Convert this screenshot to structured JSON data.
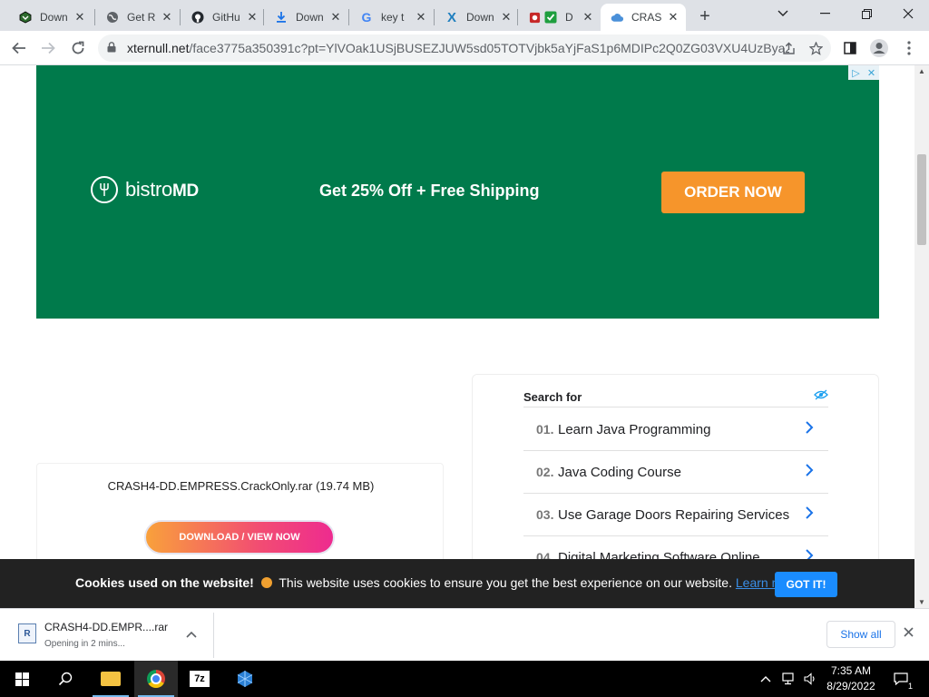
{
  "browser": {
    "tabs": [
      {
        "title": "Down",
        "icon": "download-site-icon"
      },
      {
        "title": "Get R",
        "icon": "globe-icon"
      },
      {
        "title": "GitHu",
        "icon": "github-icon"
      },
      {
        "title": "Down",
        "icon": "download-arrow-icon"
      },
      {
        "title": "key t",
        "icon": "google-icon"
      },
      {
        "title": "Down",
        "icon": "x-logo-icon"
      },
      {
        "title": "D",
        "icon": "shield-check-icon"
      },
      {
        "title": "CRAS",
        "icon": "cloud-icon"
      }
    ],
    "active_tab_index": 7,
    "new_tab_label": "+",
    "address": {
      "host": "xternull.net",
      "path": "/face3775a350391c?pt=YlVOak1USjBUSEZJUW5sd05TOTVjbk5aYjFaS1p6MDIPc2Q0ZG03VXU4UzBya2..."
    }
  },
  "ad": {
    "badge": [
      "▷",
      "✕"
    ],
    "brand_light": "bistro",
    "brand_bold": "MD",
    "headline": "Get 25% Off + Free Shipping",
    "cta": "ORDER NOW",
    "bg_color": "#007a4b",
    "cta_color": "#f6952b"
  },
  "download_card": {
    "filename": "CRASH4-DD.EMPRESS.CrackOnly.rar (19.74 MB)",
    "button": "DOWNLOAD / VIEW NOW"
  },
  "search_box": {
    "title": "Search for",
    "items": [
      {
        "num": "01.",
        "text": "Learn Java Programming"
      },
      {
        "num": "02.",
        "text": "Java Coding Course"
      },
      {
        "num": "03.",
        "text": "Use Garage Doors Repairing Services"
      },
      {
        "num": "04.",
        "text": "Digital Marketing Software Online"
      }
    ]
  },
  "cookie_bar": {
    "title": "Cookies used on the website!",
    "message": "This website uses cookies to ensure you get the best experience on our website.",
    "link": "Learn more",
    "button": "GOT IT!"
  },
  "download_shelf": {
    "filename": "CRASH4-DD.EMPR....rar",
    "status": "Opening in 2 mins...",
    "show_all": "Show all"
  },
  "taskbar": {
    "time": "7:35 AM",
    "date": "8/29/2022",
    "notification_count": "1",
    "sevenzip_label": "7z"
  }
}
